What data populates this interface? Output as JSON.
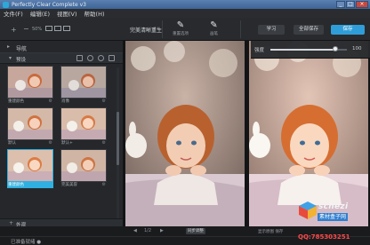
{
  "window": {
    "title": "Perfectly Clear Complete v3",
    "controls": [
      "_",
      "□",
      "×"
    ]
  },
  "menu": [
    "文件(F)",
    "编辑(E)",
    "视图(V)",
    "帮助(H)"
  ],
  "toolbar": {
    "zoom_in": "+",
    "zoom_out": "−",
    "zoom_label": "50%",
    "preset_label": "完美清晰重生",
    "dropdown": "▾",
    "tool1": {
      "glyph": "✎",
      "label": "重置选项"
    },
    "tool2": {
      "glyph": "✎",
      "label": "画笔"
    },
    "btn_learn": "学习",
    "btn_save_all": "全部保存",
    "btn_save": "保存"
  },
  "left_panel": {
    "nav_label": "导航",
    "preset_header": "预设",
    "thumbs": [
      {
        "caption": "重建颜色",
        "selected": false
      },
      {
        "caption": "肖像",
        "selected": false
      },
      {
        "caption": "默认",
        "selected": false
      },
      {
        "caption": "默认+",
        "selected": false
      },
      {
        "caption": "重建颜色",
        "selected": true
      },
      {
        "caption": "完美美容",
        "selected": false
      }
    ],
    "footer_label": "外观"
  },
  "adjust": {
    "label": "强度",
    "value": "100",
    "level": 0.85
  },
  "bottom": {
    "prev": "◀",
    "page": "1/2",
    "next": "▶",
    "chip": "同步调整",
    "right_text": "显示原图  保存"
  },
  "status": "已准备就绪 ●",
  "watermark": {
    "site": "schezi",
    "tag": "素材盒子网",
    "qq": "QQ:785303251"
  },
  "colors": {
    "accent": "#2fb0e0",
    "primary_button": "#2f9ed8",
    "titlebar": "#4a72a6"
  }
}
